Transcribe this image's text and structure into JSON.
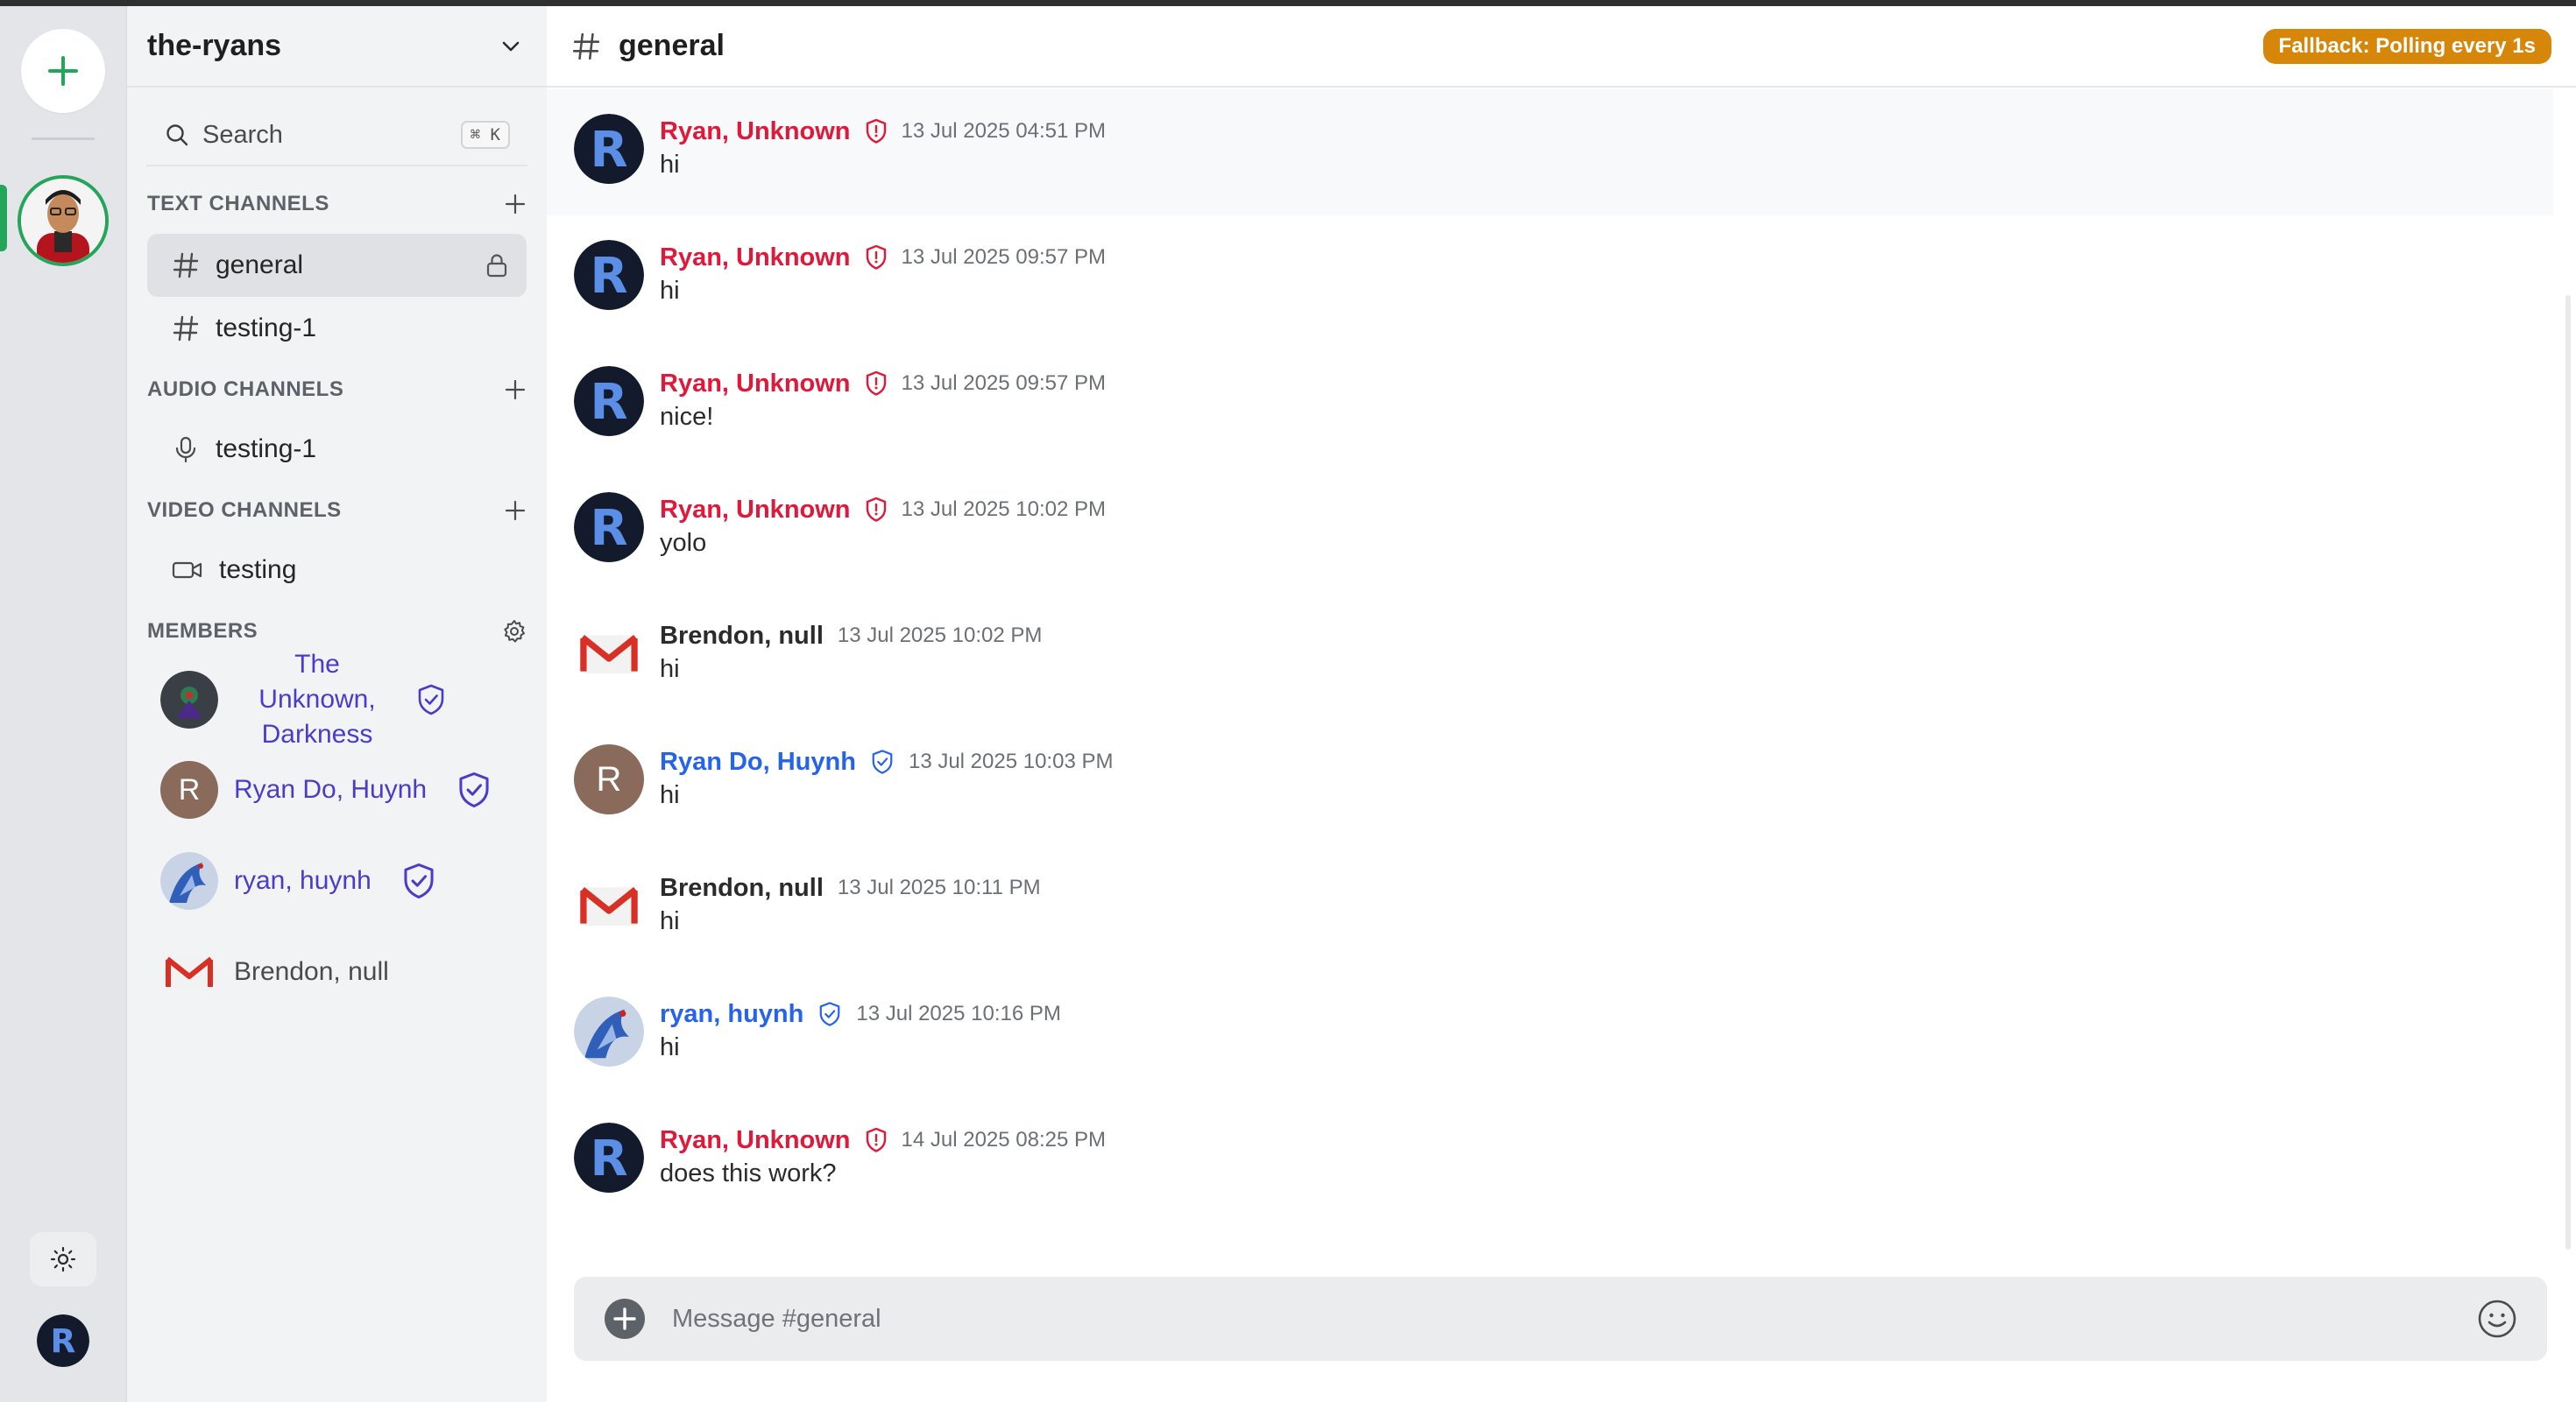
{
  "server": {
    "name": "the-ryans",
    "search": {
      "label": "Search",
      "shortcut": "⌘ K"
    },
    "sections": {
      "text": "TEXT CHANNELS",
      "audio": "AUDIO CHANNELS",
      "video": "VIDEO CHANNELS",
      "members": "MEMBERS"
    },
    "text_channels": [
      "general",
      "testing-1"
    ],
    "audio_channels": [
      "testing-1"
    ],
    "video_channels": [
      "testing"
    ],
    "members": [
      {
        "name_line1": "The Unknown,",
        "name_line2": "Darkness",
        "badge": "shield-check"
      },
      {
        "name": "Ryan Do, Huynh",
        "initial": "R",
        "badge": "shield-check"
      },
      {
        "name": "ryan, huynh",
        "badge": "shield-check"
      },
      {
        "name": "Brendon, null"
      }
    ]
  },
  "channel": {
    "name": "general",
    "status_badge": "Fallback: Polling every 1s"
  },
  "messages": [
    {
      "author": "Ryan, Unknown",
      "time": "13 Jul 2025 04:51 PM",
      "text": "hi"
    },
    {
      "author": "Ryan, Unknown",
      "time": "13 Jul 2025 09:57 PM",
      "text": "hi"
    },
    {
      "author": "Ryan, Unknown",
      "time": "13 Jul 2025 09:57 PM",
      "text": "nice!"
    },
    {
      "author": "Ryan, Unknown",
      "time": "13 Jul 2025 10:02 PM",
      "text": "yolo"
    },
    {
      "author": "Brendon, null",
      "time": "13 Jul 2025 10:02 PM",
      "text": "hi"
    },
    {
      "author": "Ryan Do, Huynh",
      "initial": "R",
      "time": "13 Jul 2025 10:03 PM",
      "text": "hi"
    },
    {
      "author": "Brendon, null",
      "time": "13 Jul 2025 10:11 PM",
      "text": "hi"
    },
    {
      "author": "ryan, huynh",
      "time": "13 Jul 2025 10:16 PM",
      "text": "hi"
    },
    {
      "author": "Ryan, Unknown",
      "time": "14 Jul 2025 08:25 PM",
      "text": "does this work?"
    }
  ],
  "composer": {
    "placeholder": "Message #general"
  },
  "colors": {
    "accent_green": "#23a55a",
    "admin_red": "#e0193a",
    "mod_blue": "#2563eb",
    "member_purple": "#4a3cc9",
    "fallback_orange": "#d6870a"
  },
  "icons": [
    "plus-icon",
    "chevron-down-icon",
    "search-icon",
    "hash-icon",
    "lock-icon",
    "microphone-icon",
    "video-camera-icon",
    "gear-icon",
    "shield-alert-icon",
    "shield-check-icon",
    "sun-icon",
    "emoji-icon",
    "gmail-icon"
  ]
}
